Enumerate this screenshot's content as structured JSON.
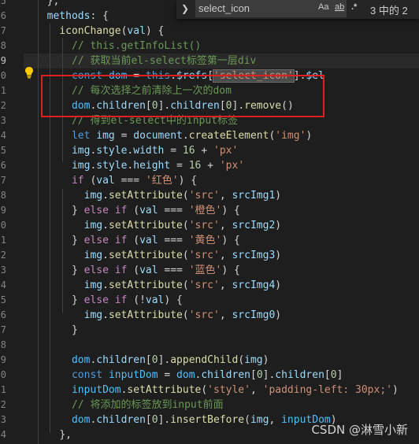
{
  "find_widget": {
    "query": "select_icon",
    "option_case": "Aa",
    "option_word": "ab",
    "option_regex": ".*",
    "match_count": "3 中的 2"
  },
  "gutter": {
    "numbers": [
      "5",
      "6",
      "7",
      "8",
      "9",
      "0",
      "1",
      "2",
      "3",
      "4",
      "5",
      "6",
      "7",
      "8",
      "9",
      "0",
      "1",
      "2",
      "3",
      "4",
      "5",
      "6",
      "7",
      "8",
      "9",
      "0",
      "1",
      "2",
      "3",
      "4"
    ],
    "active_index": 4
  },
  "code": [
    {
      "indent": "  ",
      "tokens": [
        [
          "pl",
          "},"
        ]
      ]
    },
    {
      "indent": "  ",
      "tokens": [
        [
          "var",
          "methods"
        ],
        [
          "pl",
          ": {"
        ]
      ]
    },
    {
      "indent": "    ",
      "tokens": [
        [
          "fn",
          "iconChange"
        ],
        [
          "pl",
          "("
        ],
        [
          "var",
          "val"
        ],
        [
          "pl",
          ") {"
        ]
      ]
    },
    {
      "indent": "      ",
      "tokens": [
        [
          "com",
          "// this.getInfoList()"
        ]
      ]
    },
    {
      "indent": "      ",
      "tokens": [
        [
          "com",
          "// 获取当前el-select标签第一层div"
        ]
      ]
    },
    {
      "indent": "      ",
      "tokens": [
        [
          "kw",
          "const"
        ],
        [
          "pl",
          " "
        ],
        [
          "const",
          "dom"
        ],
        [
          "pl",
          " = "
        ],
        [
          "kw",
          "this"
        ],
        [
          "pl",
          "."
        ],
        [
          "var",
          "$refs"
        ],
        [
          "pl",
          "["
        ],
        [
          "strhl",
          "'select_icon'"
        ],
        [
          "pl",
          "]."
        ],
        [
          "var",
          "$el"
        ]
      ]
    },
    {
      "indent": "      ",
      "tokens": [
        [
          "com",
          "// 每次选择之前清除上一次的dom"
        ]
      ]
    },
    {
      "indent": "      ",
      "tokens": [
        [
          "const",
          "dom"
        ],
        [
          "pl",
          "."
        ],
        [
          "var",
          "children"
        ],
        [
          "pl",
          "["
        ],
        [
          "num",
          "0"
        ],
        [
          "pl",
          "]."
        ],
        [
          "var",
          "children"
        ],
        [
          "pl",
          "["
        ],
        [
          "num",
          "0"
        ],
        [
          "pl",
          "]."
        ],
        [
          "fn",
          "remove"
        ],
        [
          "pl",
          "()"
        ]
      ]
    },
    {
      "indent": "      ",
      "tokens": [
        [
          "com",
          "// 得到el-select中的input标签"
        ]
      ]
    },
    {
      "indent": "      ",
      "tokens": [
        [
          "kw",
          "let"
        ],
        [
          "pl",
          " "
        ],
        [
          "var",
          "img"
        ],
        [
          "pl",
          " = "
        ],
        [
          "var",
          "document"
        ],
        [
          "pl",
          "."
        ],
        [
          "fn",
          "createElement"
        ],
        [
          "pl",
          "("
        ],
        [
          "str",
          "'img'"
        ],
        [
          "pl",
          ")"
        ]
      ]
    },
    {
      "indent": "      ",
      "tokens": [
        [
          "var",
          "img"
        ],
        [
          "pl",
          "."
        ],
        [
          "var",
          "style"
        ],
        [
          "pl",
          "."
        ],
        [
          "var",
          "width"
        ],
        [
          "pl",
          " = "
        ],
        [
          "num",
          "16"
        ],
        [
          "pl",
          " + "
        ],
        [
          "str",
          "'px'"
        ]
      ]
    },
    {
      "indent": "      ",
      "tokens": [
        [
          "var",
          "img"
        ],
        [
          "pl",
          "."
        ],
        [
          "var",
          "style"
        ],
        [
          "pl",
          "."
        ],
        [
          "var",
          "height"
        ],
        [
          "pl",
          " = "
        ],
        [
          "num",
          "16"
        ],
        [
          "pl",
          " + "
        ],
        [
          "str",
          "'px'"
        ]
      ]
    },
    {
      "indent": "      ",
      "tokens": [
        [
          "kw2",
          "if"
        ],
        [
          "pl",
          " ("
        ],
        [
          "var",
          "val"
        ],
        [
          "pl",
          " === "
        ],
        [
          "str",
          "'红色'"
        ],
        [
          "pl",
          ") {"
        ]
      ]
    },
    {
      "indent": "        ",
      "tokens": [
        [
          "var",
          "img"
        ],
        [
          "pl",
          "."
        ],
        [
          "fn",
          "setAttribute"
        ],
        [
          "pl",
          "("
        ],
        [
          "str",
          "'src'"
        ],
        [
          "pl",
          ", "
        ],
        [
          "var",
          "srcImg1"
        ],
        [
          "pl",
          ")"
        ]
      ]
    },
    {
      "indent": "      ",
      "tokens": [
        [
          "pl",
          "} "
        ],
        [
          "kw2",
          "else if"
        ],
        [
          "pl",
          " ("
        ],
        [
          "var",
          "val"
        ],
        [
          "pl",
          " === "
        ],
        [
          "str",
          "'橙色'"
        ],
        [
          "pl",
          ") {"
        ]
      ]
    },
    {
      "indent": "        ",
      "tokens": [
        [
          "var",
          "img"
        ],
        [
          "pl",
          "."
        ],
        [
          "fn",
          "setAttribute"
        ],
        [
          "pl",
          "("
        ],
        [
          "str",
          "'src'"
        ],
        [
          "pl",
          ", "
        ],
        [
          "var",
          "srcImg2"
        ],
        [
          "pl",
          ")"
        ]
      ]
    },
    {
      "indent": "      ",
      "tokens": [
        [
          "pl",
          "} "
        ],
        [
          "kw2",
          "else if"
        ],
        [
          "pl",
          " ("
        ],
        [
          "var",
          "val"
        ],
        [
          "pl",
          " === "
        ],
        [
          "str",
          "'黄色'"
        ],
        [
          "pl",
          ") {"
        ]
      ]
    },
    {
      "indent": "        ",
      "tokens": [
        [
          "var",
          "img"
        ],
        [
          "pl",
          "."
        ],
        [
          "fn",
          "setAttribute"
        ],
        [
          "pl",
          "("
        ],
        [
          "str",
          "'src'"
        ],
        [
          "pl",
          ", "
        ],
        [
          "var",
          "srcImg3"
        ],
        [
          "pl",
          ")"
        ]
      ]
    },
    {
      "indent": "      ",
      "tokens": [
        [
          "pl",
          "} "
        ],
        [
          "kw2",
          "else if"
        ],
        [
          "pl",
          " ("
        ],
        [
          "var",
          "val"
        ],
        [
          "pl",
          " === "
        ],
        [
          "str",
          "'蓝色'"
        ],
        [
          "pl",
          ") {"
        ]
      ]
    },
    {
      "indent": "        ",
      "tokens": [
        [
          "var",
          "img"
        ],
        [
          "pl",
          "."
        ],
        [
          "fn",
          "setAttribute"
        ],
        [
          "pl",
          "("
        ],
        [
          "str",
          "'src'"
        ],
        [
          "pl",
          ", "
        ],
        [
          "var",
          "srcImg4"
        ],
        [
          "pl",
          ")"
        ]
      ]
    },
    {
      "indent": "      ",
      "tokens": [
        [
          "pl",
          "} "
        ],
        [
          "kw2",
          "else if"
        ],
        [
          "pl",
          " (!"
        ],
        [
          "var",
          "val"
        ],
        [
          "pl",
          ") {"
        ]
      ]
    },
    {
      "indent": "        ",
      "tokens": [
        [
          "var",
          "img"
        ],
        [
          "pl",
          "."
        ],
        [
          "fn",
          "setAttribute"
        ],
        [
          "pl",
          "("
        ],
        [
          "str",
          "'src'"
        ],
        [
          "pl",
          ", "
        ],
        [
          "var",
          "srcImg0"
        ],
        [
          "pl",
          ")"
        ]
      ]
    },
    {
      "indent": "      ",
      "tokens": [
        [
          "pl",
          "}"
        ]
      ]
    },
    {
      "indent": "",
      "tokens": []
    },
    {
      "indent": "      ",
      "tokens": [
        [
          "const",
          "dom"
        ],
        [
          "pl",
          "."
        ],
        [
          "var",
          "children"
        ],
        [
          "pl",
          "["
        ],
        [
          "num",
          "0"
        ],
        [
          "pl",
          "]."
        ],
        [
          "fn",
          "appendChild"
        ],
        [
          "pl",
          "("
        ],
        [
          "var",
          "img"
        ],
        [
          "pl",
          ")"
        ]
      ]
    },
    {
      "indent": "      ",
      "tokens": [
        [
          "kw",
          "const"
        ],
        [
          "pl",
          " "
        ],
        [
          "const",
          "inputDom"
        ],
        [
          "pl",
          " = "
        ],
        [
          "const",
          "dom"
        ],
        [
          "pl",
          "."
        ],
        [
          "var",
          "children"
        ],
        [
          "pl",
          "["
        ],
        [
          "num",
          "0"
        ],
        [
          "pl",
          "]."
        ],
        [
          "var",
          "children"
        ],
        [
          "pl",
          "["
        ],
        [
          "num",
          "0"
        ],
        [
          "pl",
          "]"
        ]
      ]
    },
    {
      "indent": "      ",
      "tokens": [
        [
          "const",
          "inputDom"
        ],
        [
          "pl",
          "."
        ],
        [
          "fn",
          "setAttribute"
        ],
        [
          "pl",
          "("
        ],
        [
          "str",
          "'style'"
        ],
        [
          "pl",
          ", "
        ],
        [
          "str",
          "'padding-left: 30px;'"
        ],
        [
          "pl",
          ")"
        ]
      ]
    },
    {
      "indent": "      ",
      "tokens": [
        [
          "com",
          "// 将添加的标签放到input前面"
        ]
      ]
    },
    {
      "indent": "      ",
      "tokens": [
        [
          "const",
          "dom"
        ],
        [
          "pl",
          "."
        ],
        [
          "var",
          "children"
        ],
        [
          "pl",
          "["
        ],
        [
          "num",
          "0"
        ],
        [
          "pl",
          "]."
        ],
        [
          "fn",
          "insertBefore"
        ],
        [
          "pl",
          "("
        ],
        [
          "var",
          "img"
        ],
        [
          "pl",
          ", "
        ],
        [
          "const",
          "inputDom"
        ],
        [
          "pl",
          ")"
        ]
      ]
    },
    {
      "indent": "    ",
      "tokens": [
        [
          "pl",
          "},"
        ]
      ]
    }
  ],
  "watermark": "CSDN @淋雪小新"
}
